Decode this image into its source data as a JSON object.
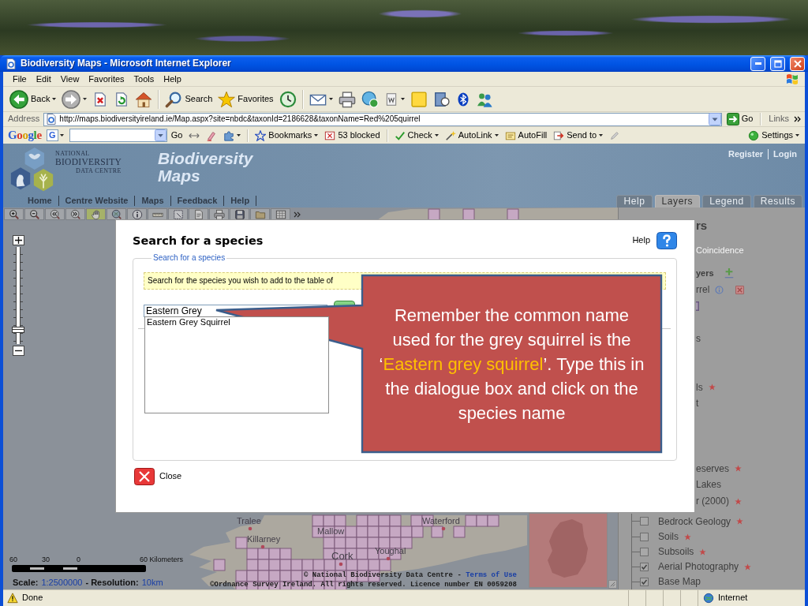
{
  "window": {
    "title": "Biodiversity Maps - Microsoft Internet Explorer"
  },
  "menu_bar": [
    "File",
    "Edit",
    "View",
    "Favorites",
    "Tools",
    "Help"
  ],
  "toolbar": [
    {
      "kind": "back",
      "label": "Back",
      "dropdown": true,
      "disabled": false
    },
    {
      "kind": "forward",
      "dropdown": true,
      "disabled": true
    },
    {
      "kind": "stop",
      "dropdown": false,
      "disabled": false
    },
    {
      "kind": "refresh",
      "dropdown": false,
      "disabled": false
    },
    {
      "kind": "home",
      "dropdown": false,
      "disabled": false
    },
    {
      "kind": "separator"
    },
    {
      "kind": "search",
      "label": "Search",
      "dropdown": false,
      "disabled": false
    },
    {
      "kind": "favorites",
      "label": "Favorites",
      "dropdown": false,
      "disabled": false
    },
    {
      "kind": "history",
      "dropdown": false,
      "disabled": false
    },
    {
      "kind": "separator"
    },
    {
      "kind": "mail",
      "dropdown": true,
      "disabled": false
    },
    {
      "kind": "print",
      "dropdown": false,
      "disabled": false
    },
    {
      "kind": "messenger",
      "dropdown": false,
      "disabled": false
    },
    {
      "kind": "edit",
      "dropdown": true,
      "disabled": false
    },
    {
      "kind": "note",
      "dropdown": false,
      "disabled": false
    },
    {
      "kind": "research",
      "dropdown": false,
      "disabled": false
    },
    {
      "kind": "bluetooth",
      "dropdown": false,
      "disabled": false
    },
    {
      "kind": "contacts",
      "dropdown": false,
      "disabled": false
    }
  ],
  "address_bar": {
    "label": "Address",
    "url": "http://maps.biodiversityireland.ie/Map.aspx?site=nbdc&taxonId=2186628&taxonName=Red%205quirrel",
    "go": "Go",
    "links": "Links"
  },
  "google_toolbar": {
    "logo": "Google",
    "engine": "G",
    "go": "Go",
    "items": [
      {
        "kind": "arrows",
        "dropdown": false
      },
      {
        "kind": "highlighter",
        "dropdown": false
      },
      {
        "kind": "puzzle",
        "dropdown": true
      },
      {
        "kind": "separator"
      },
      {
        "kind": "bookmarks",
        "label": "Bookmarks",
        "dropdown": true
      },
      {
        "kind": "blocker",
        "label": "53 blocked",
        "dropdown": false
      },
      {
        "kind": "separator"
      },
      {
        "kind": "spellcheck",
        "label": "Check",
        "dropdown": true
      },
      {
        "kind": "autolink",
        "label": "AutoLink",
        "dropdown": true
      },
      {
        "kind": "autofill",
        "label": "AutoFill",
        "dropdown": false
      },
      {
        "kind": "send",
        "label": "Send to",
        "dropdown": true
      },
      {
        "kind": "pencil",
        "dropdown": false
      }
    ],
    "settings": "Settings"
  },
  "site": {
    "logo_text": [
      "NATIONAL",
      "BIODIVERSITY",
      "DATA CENTRE"
    ],
    "title": [
      "Biodiversity",
      "Maps"
    ],
    "account_links": [
      "Register",
      "Login"
    ],
    "nav": [
      "Home",
      "Centre Website",
      "Maps",
      "Feedback",
      "Help"
    ],
    "panel_tabs": [
      {
        "label": "Help",
        "selected": false
      },
      {
        "label": "Layers",
        "selected": true
      },
      {
        "label": "Legend",
        "selected": false
      },
      {
        "label": "Results",
        "selected": false
      }
    ]
  },
  "map": {
    "tools": [
      {
        "kind": "zoom-in",
        "selected": false
      },
      {
        "kind": "zoom-out",
        "selected": false
      },
      {
        "kind": "previous",
        "selected": false
      },
      {
        "kind": "next",
        "selected": false
      },
      {
        "kind": "pan",
        "selected": true
      },
      {
        "kind": "full-extent",
        "selected": false
      },
      {
        "kind": "identify",
        "selected": false
      },
      {
        "kind": "measure",
        "selected": false
      },
      {
        "kind": "select",
        "selected": false
      },
      {
        "kind": "report",
        "selected": false
      },
      {
        "kind": "print",
        "selected": false
      },
      {
        "kind": "save",
        "selected": false
      },
      {
        "kind": "open",
        "selected": false
      },
      {
        "kind": "table",
        "selected": false
      },
      {
        "kind": "more",
        "selected": false
      }
    ],
    "zoom_slider": {
      "level": 0.12
    },
    "towns": [
      "Tralee",
      "Killarney",
      "Mallow",
      "Cork",
      "Youghal",
      "Waterford"
    ],
    "scale_bar": [
      "60",
      "30",
      "0",
      "60 Kilometers"
    ],
    "scale": {
      "label": "Scale:",
      "value": "1:2500000"
    },
    "resolution": {
      "label": "- Resolution:",
      "value": "10km"
    },
    "credit": {
      "text": "© National Biodiversity Data Centre -",
      "link": "Terms of Use"
    },
    "licence": "©Ordnance Survey Ireland. All rights reserved. Licence number EN 0059208"
  },
  "layers_panel": {
    "items": [
      {
        "kind": "heading",
        "label": "rs",
        "starred": false
      },
      {
        "kind": "option",
        "label": "Coincidence",
        "starred": false
      },
      {
        "kind": "section",
        "label": "yers",
        "starred": false
      },
      {
        "kind": "layer",
        "label": "rrel",
        "starred": false
      },
      {
        "kind": "fragment",
        "label": "s",
        "starred": false
      },
      {
        "kind": "fragment",
        "label": "ls",
        "starred": true
      },
      {
        "kind": "fragment",
        "label": "t",
        "starred": false
      },
      {
        "kind": "fragment",
        "label": "eserves",
        "starred": true
      },
      {
        "kind": "fragment",
        "label": "Lakes",
        "starred": false
      },
      {
        "kind": "fragment",
        "label": "r (2000)",
        "starred": true
      },
      {
        "kind": "checkbox",
        "label": "Bedrock Geology",
        "checked": false,
        "starred": true
      },
      {
        "kind": "checkbox",
        "label": "Soils",
        "checked": false,
        "starred": true
      },
      {
        "kind": "checkbox",
        "label": "Subsoils",
        "checked": false,
        "starred": true
      },
      {
        "kind": "checkbox",
        "label": "Aerial Photography",
        "checked": true,
        "starred": true
      },
      {
        "kind": "checkbox",
        "label": "Base Map",
        "checked": true,
        "starred": false
      }
    ]
  },
  "dialog": {
    "title": "Search for a species",
    "help": "Help",
    "legend": "Search for a species",
    "hint": "Search for the species you wish to add to the table of",
    "query": "Eastern Grey",
    "suggestions": [
      {
        "label": "Eastern Grey Squirrel",
        "selected": false
      }
    ],
    "close": "Close"
  },
  "callout": {
    "segments": [
      {
        "text": "Remember the common name used for the grey squirrel is the ‘",
        "highlighted": false
      },
      {
        "text": "Eastern grey squirrel",
        "highlighted": true
      },
      {
        "text": "’. Type this in the dialogue box and click on the species name",
        "highlighted": false
      }
    ]
  },
  "status_bar": {
    "text": "Done",
    "zone": "Internet"
  }
}
